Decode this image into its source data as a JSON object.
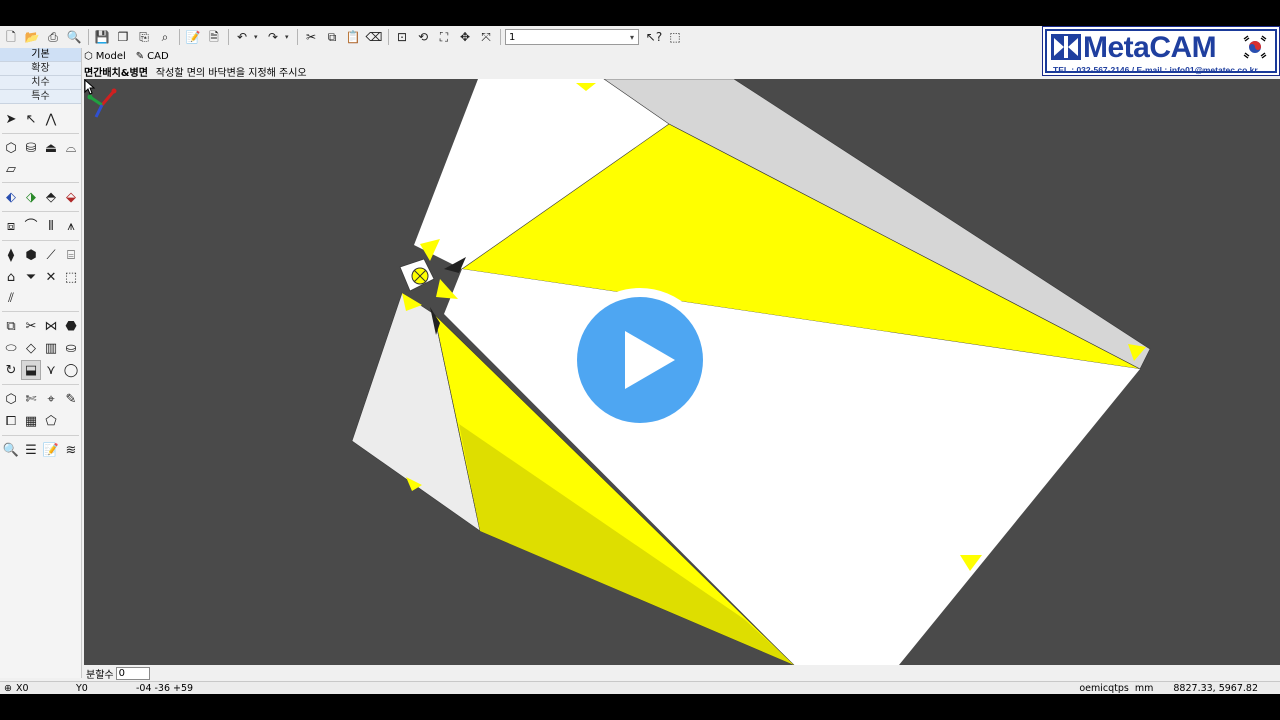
{
  "toolbar": {
    "icons": [
      "new-file-icon",
      "open-folder-icon",
      "print-icon",
      "print-preview-icon",
      "save-icon",
      "save-all-icon",
      "import-icon",
      "export-icon",
      "notes-icon",
      "document-icon",
      "undo-icon",
      "redo-icon",
      "cut-icon",
      "copy-icon",
      "paste-icon",
      "eraser-icon",
      "zoom-window-icon",
      "zoom-previous-icon",
      "zoom-fit-icon",
      "pan-icon",
      "orbit-icon",
      "help-pointer-icon",
      "properties-icon"
    ],
    "layer_combo_value": "1"
  },
  "logo": {
    "title": "MetaCAM",
    "contact": "TEL : 032-567-2146 / E-mail : info01@metatec.co.kr"
  },
  "left_panel": {
    "tabs": [
      "기본",
      "확장",
      "치수",
      "특수"
    ],
    "active_tab": "기본"
  },
  "view_tabs": [
    {
      "label": "Model",
      "glyph": "⬡"
    },
    {
      "label": "CAD",
      "glyph": "✎"
    }
  ],
  "prompt": {
    "command": "면간배치&병면",
    "message": "작성할 면의 바닥변을 지정해 주시오"
  },
  "input_bar": {
    "label": "분할수",
    "value": "0"
  },
  "status_bar": {
    "x_label": "X0",
    "y_label": "Y0",
    "offsets": "-04  -36  +59",
    "mode": "oemicqtps",
    "units": "mm",
    "coords": "8827.33, 5967.82"
  },
  "colors": {
    "viewport_bg": "#4a4a4a",
    "face_yellow": "#ffff00",
    "face_yellow_dark": "#dede00",
    "face_white": "#ffffff",
    "face_gray": "#d6d6d6",
    "play_blue": "#4ea6f2",
    "logo_blue": "#1f3f9f"
  }
}
